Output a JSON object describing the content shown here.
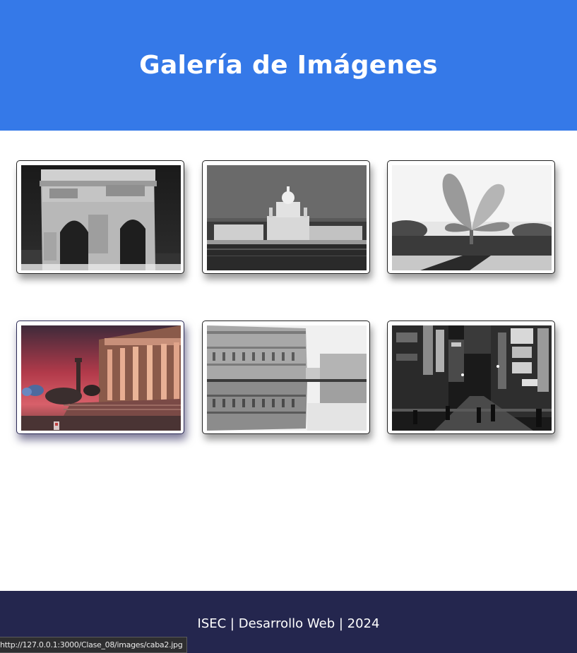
{
  "header": {
    "title": "Galería de Imágenes"
  },
  "gallery": {
    "images": [
      {
        "subject": "arch-monument",
        "tone": "grayscale"
      },
      {
        "subject": "city-skyline-waterfront",
        "tone": "grayscale"
      },
      {
        "subject": "flower-sculpture",
        "tone": "grayscale"
      },
      {
        "subject": "columned-building-at-sunset",
        "tone": "color",
        "selected": true
      },
      {
        "subject": "palace-reflection",
        "tone": "grayscale"
      },
      {
        "subject": "night-street-signs",
        "tone": "grayscale"
      }
    ]
  },
  "footer": {
    "text": "ISEC | Desarrollo Web | 2024"
  },
  "statusbar": {
    "url": "http://127.0.0.1:3000/Clase_08/images/caba2.jpg"
  },
  "colors": {
    "header_bg": "#3579e8",
    "footer_bg": "#24264e",
    "page_bg": "#ffffff"
  }
}
